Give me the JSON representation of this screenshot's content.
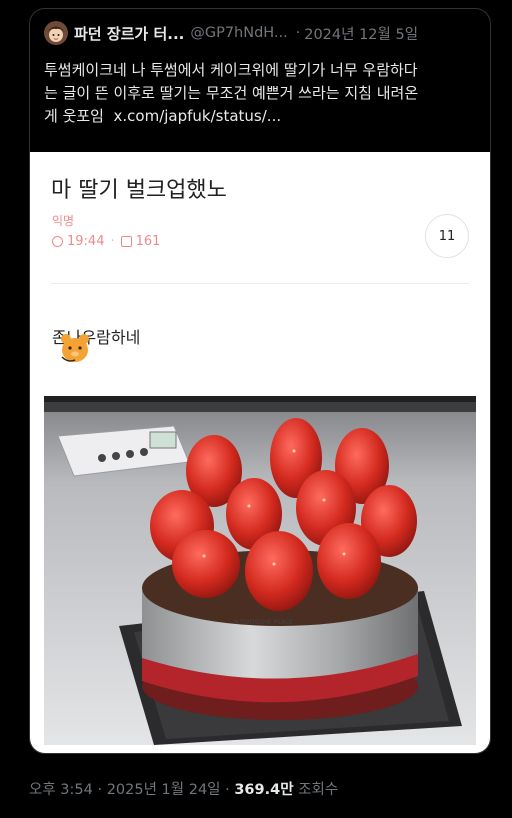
{
  "tweet": {
    "display_name": "파던 장르가 터...",
    "handle": "@GP7hNdH...",
    "separator": "·",
    "date": "2024년 12월 5일",
    "text_line1": "투썸케이크네 나 투썸에서 케이크위에 딸기가 너무 우람하다",
    "text_line2": "는 글이 뜬 이후로 딸기는 무조건 예쁜거 쓰라는 지침 내려온",
    "text_line3": "게 웃포임",
    "link": "x.com/japfuk/status/..."
  },
  "embed": {
    "title": "마 딸기 벌크업했노",
    "author": "익명",
    "time": "19:44",
    "meta_sep": "·",
    "views": "161",
    "comment_count": "11",
    "body_text": "존나우람하네"
  },
  "footer": {
    "time": "오후 3:54",
    "sep1": "·",
    "date": "2025년 1월 24일",
    "sep2": "·",
    "view_count": "369.4만",
    "view_label": "조회수"
  },
  "colors": {
    "background": "#000000",
    "meta_pink": "#f08a8a",
    "muted": "#71767b"
  },
  "icons": {
    "avatar": "cartoon-avatar",
    "time": "clock-icon",
    "views": "document-icon",
    "sticker": "bear-sticker"
  }
}
